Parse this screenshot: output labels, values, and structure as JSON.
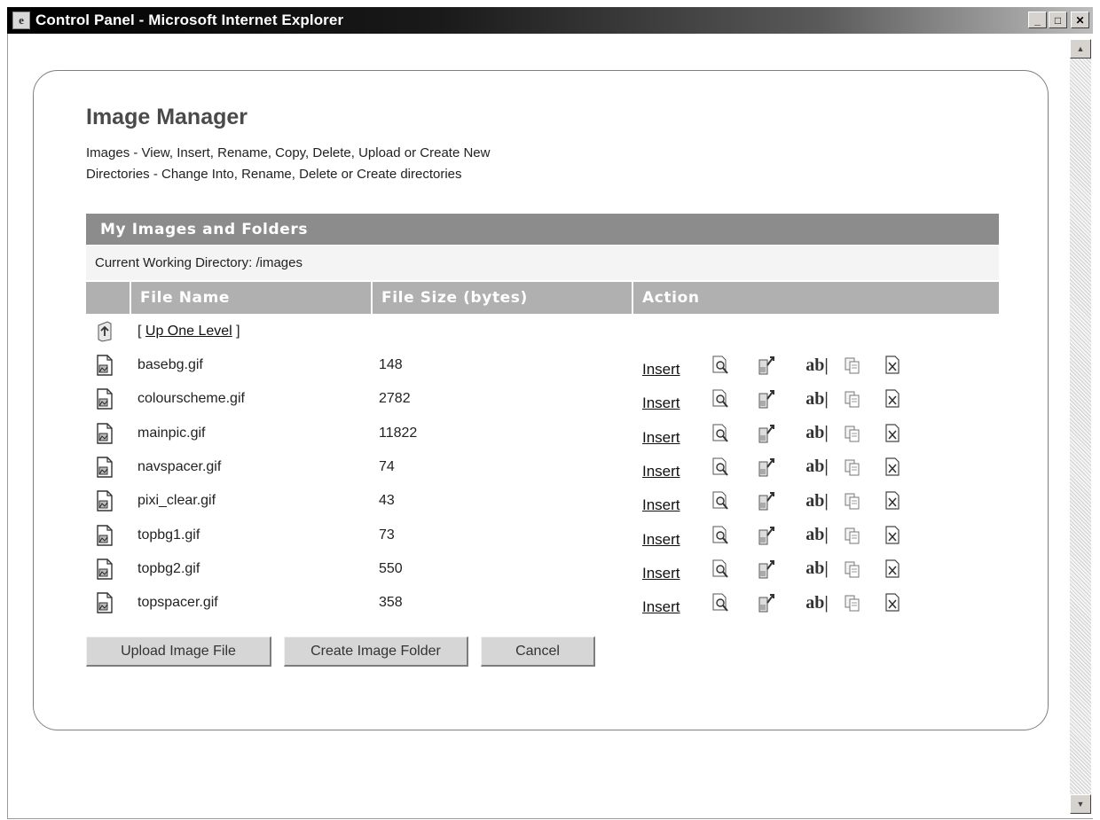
{
  "window": {
    "title": "Control Panel - Microsoft Internet Explorer",
    "minimize": "_",
    "maximize": "□",
    "close": "✕"
  },
  "page": {
    "title": "Image Manager",
    "description_line1": "Images - View, Insert, Rename, Copy, Delete, Upload or Create New",
    "description_line2": "Directories - Change Into, Rename, Delete or Create directories"
  },
  "section": {
    "title": "My Images and Folders",
    "current_dir_label": "Current Working Directory:",
    "current_dir": "/images"
  },
  "table": {
    "headers": [
      "",
      "File Name",
      "File Size (bytes)",
      "Action"
    ],
    "up_level": "Up One Level",
    "insert_label": "Insert",
    "rename_glyph": "ab|",
    "rows": [
      {
        "name": "basebg.gif",
        "size": "148"
      },
      {
        "name": "colourscheme.gif",
        "size": "2782"
      },
      {
        "name": "mainpic.gif",
        "size": "11822"
      },
      {
        "name": "navspacer.gif",
        "size": "74"
      },
      {
        "name": "pixi_clear.gif",
        "size": "43"
      },
      {
        "name": "topbg1.gif",
        "size": "73"
      },
      {
        "name": "topbg2.gif",
        "size": "550"
      },
      {
        "name": "topspacer.gif",
        "size": "358"
      }
    ],
    "row_icons": [
      "image-file-icon",
      "view-icon",
      "move-icon",
      "rename-icon",
      "copy-icon",
      "delete-icon"
    ]
  },
  "buttons": {
    "upload": "Upload Image File",
    "create_folder": "Create Image Folder",
    "cancel": "Cancel"
  }
}
